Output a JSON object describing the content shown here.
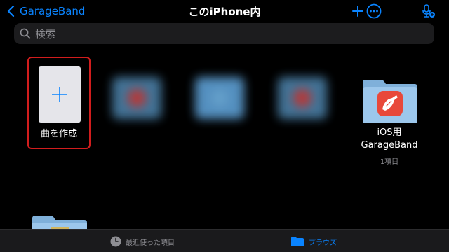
{
  "nav": {
    "back_label": "GarageBand",
    "title": "このiPhone内",
    "add_icon": "plus-icon",
    "more_icon": "ellipsis-circle-icon",
    "mic_icon": "mic-plus-icon"
  },
  "search": {
    "placeholder": "検索"
  },
  "items": [
    {
      "label": "曲を作成",
      "icon": "plus-icon"
    },
    {
      "label": "iOS用",
      "label2": "GarageBand",
      "count": "1項目",
      "icon": "folder-icon"
    }
  ],
  "tabbar": {
    "recents_label": "最近使った項目",
    "browse_label": "ブラウズ"
  },
  "colors": {
    "accent": "#0a84ff",
    "highlight_border": "#d21d1d",
    "folder": "#8fbbe0"
  }
}
